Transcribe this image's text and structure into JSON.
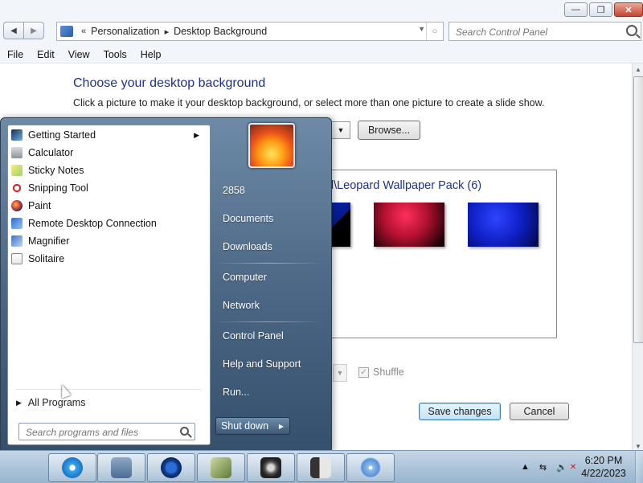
{
  "window": {
    "minimize_symbol": "—",
    "maximize_symbol": "❐",
    "close_symbol": "✕"
  },
  "address": {
    "back_symbol": "◀",
    "forward_symbol": "▶",
    "chevron": "«",
    "crumbs": [
      "Personalization",
      "Desktop Background"
    ],
    "separator": "▸",
    "dropdown_symbol": "▼",
    "refresh_symbol": "○",
    "search_placeholder": "Search Control Panel"
  },
  "menubar": [
    "File",
    "Edit",
    "View",
    "Tools",
    "Help"
  ],
  "content": {
    "title": "Choose your desktop background",
    "description": "Click a picture to make it your desktop background, or select more than one picture to create a slide show.",
    "location_dropdown_symbol": "▼",
    "browse_label": "Browse...",
    "gallery_label": "d\\Leopard Wallpaper Pack (6)",
    "position_dropdown_symbol": "▼",
    "shuffle_label": "Shuffle",
    "shuffle_checked_symbol": "✓",
    "save_label": "Save changes",
    "cancel_label": "Cancel",
    "scroll_up": "▲",
    "scroll_down": "▼"
  },
  "start_menu": {
    "programs": [
      {
        "label": "Getting Started",
        "icon": "getting-started-icon",
        "has_submenu": true
      },
      {
        "label": "Calculator",
        "icon": "calculator-icon"
      },
      {
        "label": "Sticky Notes",
        "icon": "sticky-notes-icon"
      },
      {
        "label": "Snipping Tool",
        "icon": "snipping-tool-icon"
      },
      {
        "label": "Paint",
        "icon": "paint-icon"
      },
      {
        "label": "Remote Desktop Connection",
        "icon": "remote-desktop-icon"
      },
      {
        "label": "Magnifier",
        "icon": "magnifier-icon"
      },
      {
        "label": "Solitaire",
        "icon": "solitaire-icon"
      }
    ],
    "submenu_arrow": "▶",
    "all_programs_arrow": "▶",
    "all_programs_label": "All Programs",
    "search_placeholder": "Search programs and files",
    "right_items": [
      "2858",
      "Documents",
      "Downloads",
      "Computer",
      "Network",
      "Control Panel",
      "Help and Support",
      "Run..."
    ],
    "shutdown_label": "Shut down",
    "shutdown_arrow": "▶"
  },
  "taskbar": {
    "start_symbol": "",
    "apps": [
      "safari-icon",
      "finder-folder-icon",
      "quicktime-icon",
      "disk-utility-icon",
      "system-preferences-icon",
      "server-icon",
      "cd-dvd-icon"
    ],
    "tray_up_symbol": "▲",
    "tray_network_symbol": "⇆",
    "tray_volume_symbol": "🔈",
    "tray_mute_symbol": "✕",
    "time": "6:20 PM",
    "date": "4/22/2023"
  }
}
